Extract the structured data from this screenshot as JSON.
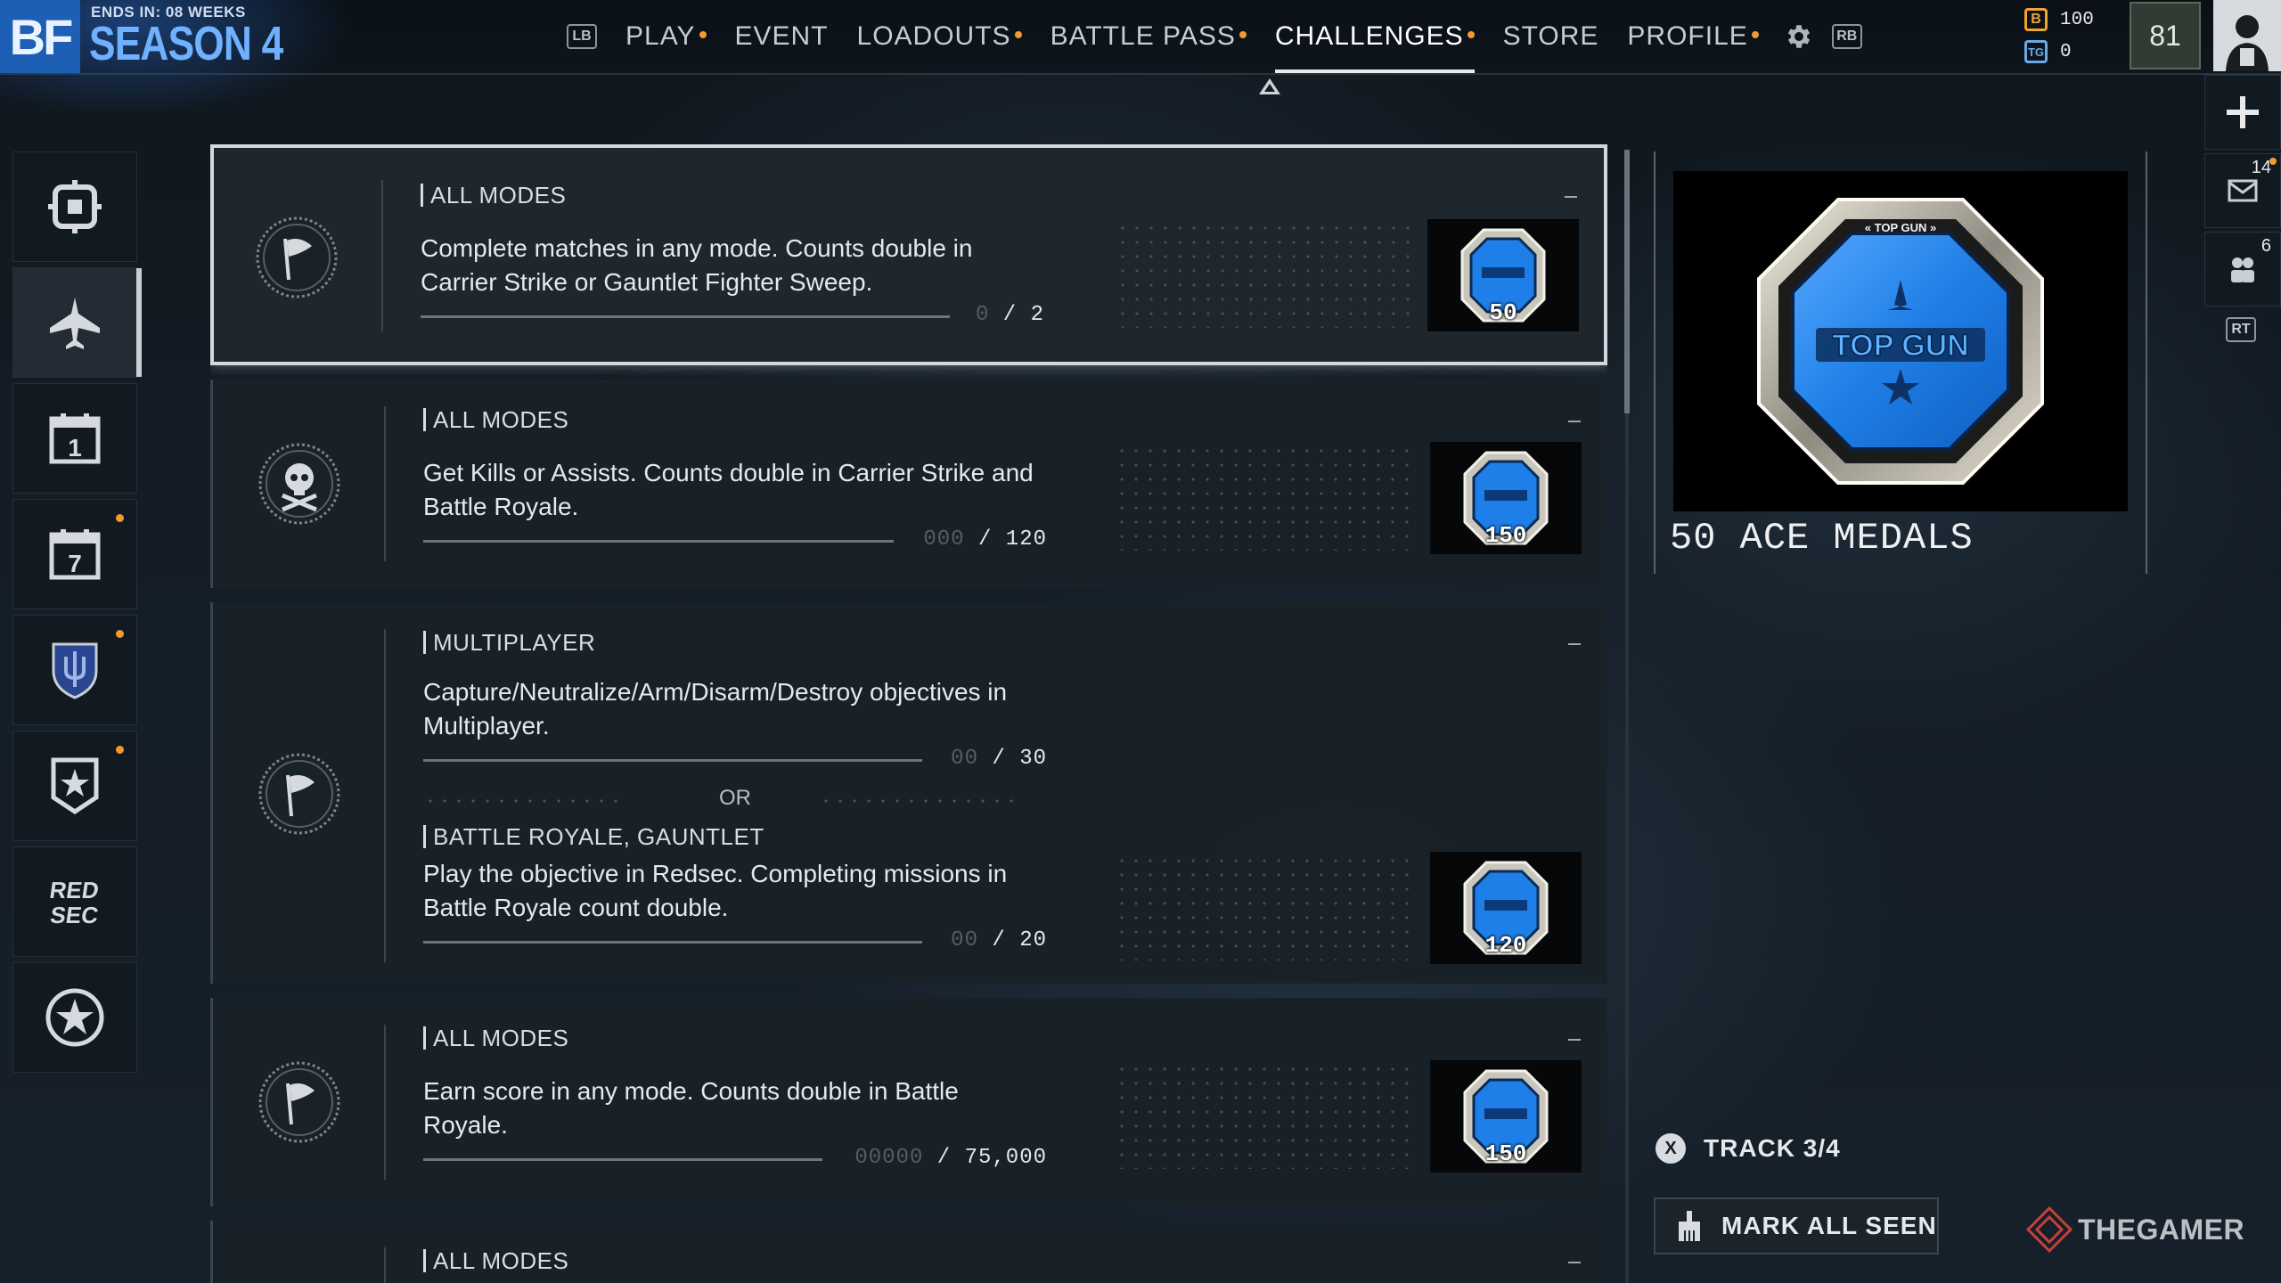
{
  "season": {
    "logo": "BF",
    "ends_in": "ENDS IN: 08 WEEKS",
    "title": "SEASON 4"
  },
  "nav": {
    "lb": "LB",
    "rb": "RB",
    "items": [
      {
        "label": "PLAY",
        "dot": true
      },
      {
        "label": "EVENT",
        "dot": false
      },
      {
        "label": "LOADOUTS",
        "dot": true
      },
      {
        "label": "BATTLE PASS",
        "dot": true
      },
      {
        "label": "CHALLENGES",
        "dot": true,
        "active": true
      },
      {
        "label": "STORE",
        "dot": false
      },
      {
        "label": "PROFILE",
        "dot": true
      }
    ]
  },
  "currency": {
    "b_icon": "B",
    "b_amount": "100",
    "tg_icon": "TG",
    "tg_amount": "0"
  },
  "player_level": "81",
  "right_column": {
    "mail_count": "14",
    "squad_count": "6",
    "rt_label": "RT"
  },
  "sidebar_icons": [
    "target-reticle-icon",
    "jet-fighter-icon",
    "daily-calendar-icon",
    "weekly-calendar-icon",
    "shield-trident-icon",
    "star-badge-icon",
    "redsec-logo-icon",
    "star-circle-icon"
  ],
  "sidebar_labels": {
    "daily": "1",
    "weekly": "7",
    "redsec_top": "RED",
    "redsec_bottom": "SEC"
  },
  "challenges": [
    {
      "mode": "ALL MODES",
      "description": "Complete matches in any mode. Counts double in Carrier Strike or Gauntlet Fighter Sweep.",
      "progress_pad": "0",
      "progress_total": "/ 2",
      "reward": "50",
      "icon": "flag-icon",
      "selected": true
    },
    {
      "mode": "ALL MODES",
      "description": "Get Kills or Assists. Counts double in Carrier Strike and Battle Royale.",
      "progress_pad": "000",
      "progress_total": "/ 120",
      "reward": "150",
      "icon": "skull-crossbones-icon"
    },
    {
      "mode": "MULTIPLAYER",
      "description": "Capture/Neutralize/Arm/Disarm/Destroy objectives in Multiplayer.",
      "progress_pad": "00",
      "progress_total": "/ 30",
      "or_label": "OR",
      "alt_mode": "BATTLE ROYALE, GAUNTLET",
      "alt_description": "Play the objective in Redsec. Completing missions in Battle Royale count double.",
      "alt_progress_pad": "00",
      "alt_progress_total": "/ 20",
      "reward": "120",
      "icon": "flag-icon"
    },
    {
      "mode": "ALL MODES",
      "description": "Earn score in any mode. Counts double in Battle Royale.",
      "progress_pad": "00000",
      "progress_total": "/ 75,000",
      "reward": "150",
      "icon": "flag-icon"
    },
    {
      "mode": "ALL MODES"
    }
  ],
  "detail": {
    "badge_top": "« TOP GUN »",
    "badge_main": "TOP GUN",
    "name": "50 ACE MEDALS"
  },
  "track": {
    "button": "X",
    "label": "TRACK 3/4"
  },
  "mark_all_seen": "MARK ALL SEEN",
  "watermark": "THEGAMER",
  "colors": {
    "accent_orange": "#f29a2e",
    "season_blue": "#6fb0ff",
    "logo_blue": "#1c5fb5",
    "medal_blue": "#1f7fe6"
  }
}
